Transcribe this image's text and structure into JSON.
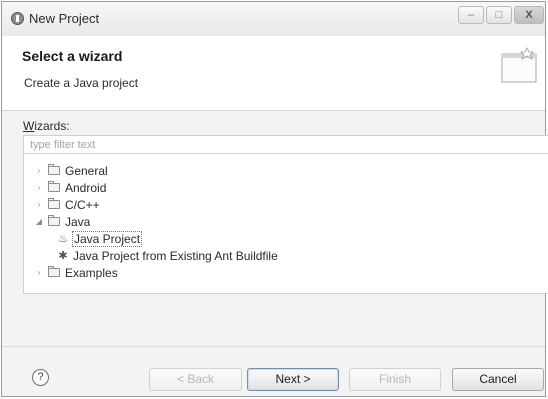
{
  "window": {
    "title": "New Project",
    "controls": {
      "minimize": "–",
      "maximize": "□",
      "close": "X"
    }
  },
  "header": {
    "title": "Select a wizard",
    "description": "Create a Java project"
  },
  "wizards_label": {
    "mnemonic": "W",
    "rest": "izards:"
  },
  "filter": {
    "value": "",
    "placeholder": "type filter text"
  },
  "tree": [
    {
      "label": "General",
      "level": 0,
      "kind": "folder",
      "expanded": false,
      "twisty": "›",
      "icon": "folder-icon"
    },
    {
      "label": "Android",
      "level": 0,
      "kind": "folder",
      "expanded": false,
      "twisty": "›",
      "icon": "folder-icon"
    },
    {
      "label": "C/C++",
      "level": 0,
      "kind": "folder",
      "expanded": false,
      "twisty": "›",
      "icon": "folder-icon"
    },
    {
      "label": "Java",
      "level": 0,
      "kind": "folder",
      "expanded": true,
      "twisty": "◢",
      "icon": "folder-icon"
    },
    {
      "label": "Java Project",
      "level": 1,
      "kind": "item",
      "selected": true,
      "glyph": "♨",
      "icon": "java-project-icon"
    },
    {
      "label": "Java Project from Existing Ant Buildfile",
      "level": 1,
      "kind": "item",
      "selected": false,
      "glyph": "✱",
      "icon": "ant-icon"
    },
    {
      "label": "Examples",
      "level": 0,
      "kind": "folder",
      "expanded": false,
      "twisty": "›",
      "icon": "folder-icon"
    }
  ],
  "buttons": {
    "help": "?",
    "back": "< Back",
    "next": "Next >",
    "finish": "Finish",
    "cancel": "Cancel"
  }
}
